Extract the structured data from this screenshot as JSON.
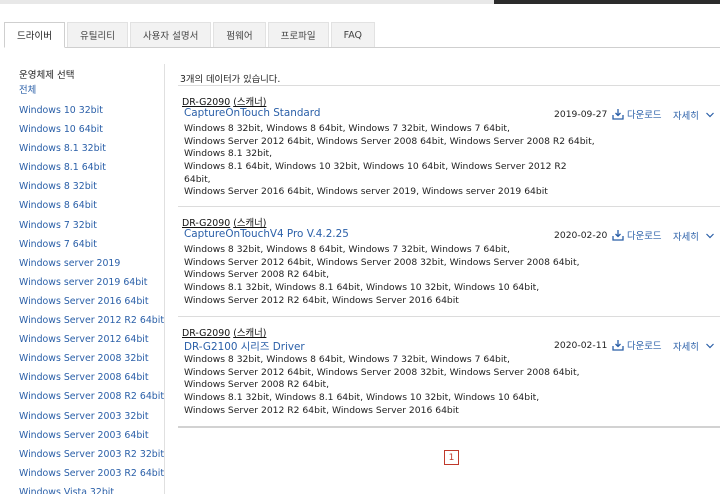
{
  "tabs": [
    {
      "label": "드라이버",
      "active": true
    },
    {
      "label": "유틸리티",
      "active": false
    },
    {
      "label": "사용자 설명서",
      "active": false
    },
    {
      "label": "펌웨어",
      "active": false
    },
    {
      "label": "프로파일",
      "active": false
    },
    {
      "label": "FAQ",
      "active": false
    }
  ],
  "sidebar": {
    "title": "운영체제 선택",
    "items": [
      "전체",
      "Windows 10 32bit",
      "Windows 10 64bit",
      "Windows 8.1 32bit",
      "Windows 8.1 64bit",
      "Windows 8 32bit",
      "Windows 8 64bit",
      "Windows 7 32bit",
      "Windows 7 64bit",
      "Windows server 2019",
      "Windows server 2019 64bit",
      "Windows Server 2016 64bit",
      "Windows Server 2012 R2 64bit",
      "Windows Server 2012 64bit",
      "Windows Server 2008 32bit",
      "Windows Server 2008 64bit",
      "Windows Server 2008 R2 64bit",
      "Windows Server 2003 32bit",
      "Windows Server 2003 64bit",
      "Windows Server 2003 R2 32bit",
      "Windows Server 2003 R2 64bit",
      "Windows Vista 32bit"
    ]
  },
  "results": {
    "count_text": "3개의 데이터가 있습니다.",
    "download_label": "다운로드",
    "detail_label": "자세히",
    "items": [
      {
        "category_model": "DR-G2090",
        "category_type": "(스캐너)",
        "title": "CaptureOnTouch Standard",
        "date": "2019-09-27",
        "os_lines": [
          "Windows 8 32bit, Windows 8 64bit, Windows 7 32bit, Windows 7 64bit,",
          "Windows Server 2012 64bit, Windows Server 2008 64bit, Windows Server 2008 R2 64bit,",
          "Windows 8.1 32bit,",
          "Windows 8.1 64bit, Windows 10 32bit, Windows 10 64bit, Windows Server 2012 R2",
          "64bit,",
          "Windows Server 2016 64bit, Windows server 2019, Windows server 2019 64bit"
        ]
      },
      {
        "category_model": "DR-G2090",
        "category_type": "(스캐너)",
        "title": "CaptureOnTouchV4 Pro V.4.2.25",
        "date": "2020-02-20",
        "os_lines": [
          "Windows 8 32bit, Windows 8 64bit, Windows 7 32bit, Windows 7 64bit,",
          "Windows Server 2012 64bit, Windows Server 2008 32bit, Windows Server 2008 64bit,",
          "Windows Server 2008 R2 64bit,",
          "Windows 8.1 32bit, Windows 8.1 64bit, Windows 10 32bit, Windows 10 64bit,",
          "Windows Server 2012 R2 64bit, Windows Server 2016 64bit"
        ]
      },
      {
        "category_model": "DR-G2090",
        "category_type": "(스캐너)",
        "title": "DR-G2100 시리즈 Driver",
        "date": "2020-02-11",
        "os_lines": [
          "Windows 8 32bit, Windows 8 64bit, Windows 7 32bit, Windows 7 64bit,",
          "Windows Server 2012 64bit, Windows Server 2008 32bit, Windows Server 2008 64bit,",
          "Windows Server 2008 R2 64bit,",
          "Windows 8.1 32bit, Windows 8.1 64bit, Windows 10 32bit, Windows 10 64bit,",
          "Windows Server 2012 R2 64bit, Windows Server 2016 64bit"
        ]
      }
    ]
  },
  "pagination": {
    "current": "1"
  },
  "icons": {
    "download": "download-icon",
    "expand": "chevron-down-icon"
  },
  "colors": {
    "link": "#2a5fa8",
    "pager": "#c0392b",
    "text": "#222222"
  }
}
